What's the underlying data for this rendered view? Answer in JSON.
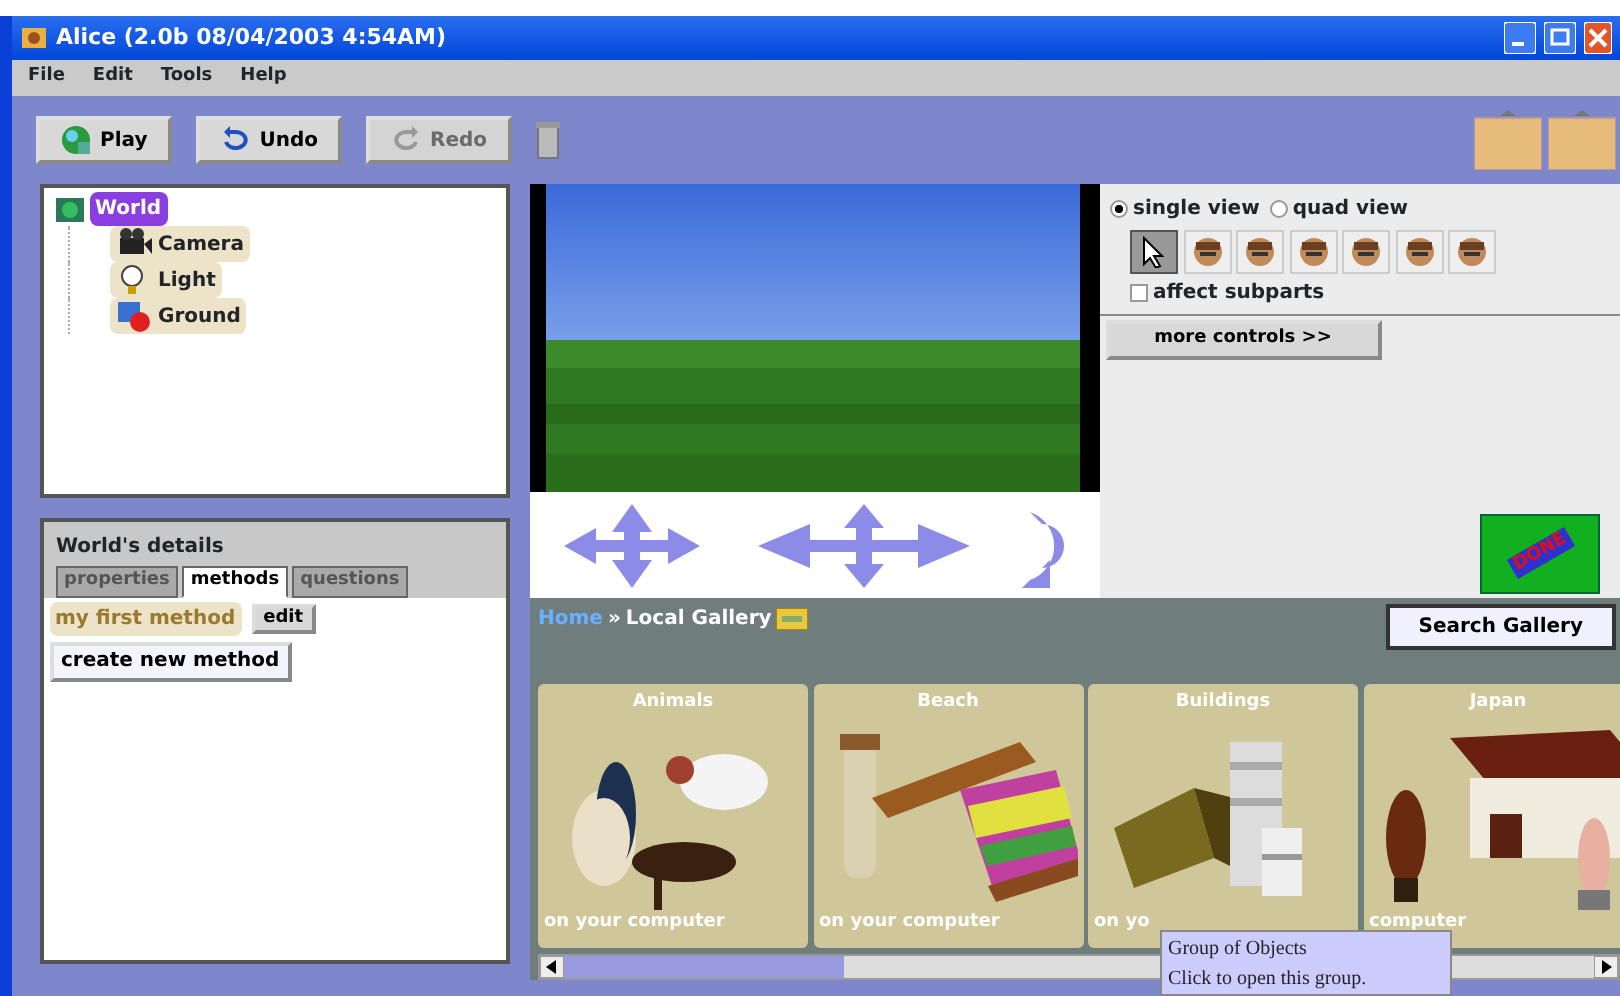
{
  "window": {
    "title": "Alice (2.0b 08/04/2003  4:54AM)"
  },
  "menu": [
    "File",
    "Edit",
    "Tools",
    "Help"
  ],
  "toolbar": [
    {
      "label": "Play",
      "kind": "play",
      "disabled": false
    },
    {
      "label": "Undo",
      "kind": "undo",
      "disabled": false
    },
    {
      "label": "Redo",
      "kind": "redo",
      "disabled": true
    }
  ],
  "object_tree": {
    "label": "World",
    "selected": true,
    "children": [
      {
        "label": "Camera",
        "kind": "camera",
        "selected": false
      },
      {
        "label": "Light",
        "kind": "light",
        "selected": false
      },
      {
        "label": "Ground",
        "kind": "ground",
        "selected": false
      }
    ]
  },
  "details": {
    "title": "World's details",
    "tabs": [
      {
        "label": "properties",
        "selected": false
      },
      {
        "label": "methods",
        "selected": true
      },
      {
        "label": "questions",
        "selected": false
      }
    ],
    "methods": [
      {
        "name": "my first method",
        "action": "edit"
      }
    ],
    "create_button": "create new method"
  },
  "view_controls": {
    "views": [
      {
        "label": "single view",
        "selected": true
      },
      {
        "label": "quad view",
        "selected": false
      }
    ],
    "tools": [
      {
        "kind": "pointer",
        "selected": true
      },
      {
        "kind": "head",
        "selected": false
      },
      {
        "kind": "head",
        "selected": false
      },
      {
        "kind": "head",
        "selected": false
      },
      {
        "kind": "head",
        "selected": false
      },
      {
        "kind": "head",
        "selected": false
      },
      {
        "kind": "head",
        "selected": false
      }
    ],
    "affect_subparts": {
      "label": "affect subparts",
      "checked": false
    },
    "more_button": "more controls >>",
    "done_button": "DONE"
  },
  "gallery": {
    "breadcrumb": [
      {
        "label": "Home",
        "kind": "link"
      },
      {
        "label": "»",
        "kind": "separator"
      },
      {
        "label": "Local Gallery",
        "kind": "current"
      }
    ],
    "search_button": "Search Gallery",
    "folders": [
      {
        "title": "Animals",
        "caption": "on your computer"
      },
      {
        "title": "Beach",
        "caption": "on your computer"
      },
      {
        "title": "Buildings",
        "caption": "on yo"
      },
      {
        "title": "Japan",
        "caption": "computer"
      }
    ]
  },
  "tooltip": {
    "lines": [
      "Group of Objects",
      "Click to open this group."
    ]
  }
}
